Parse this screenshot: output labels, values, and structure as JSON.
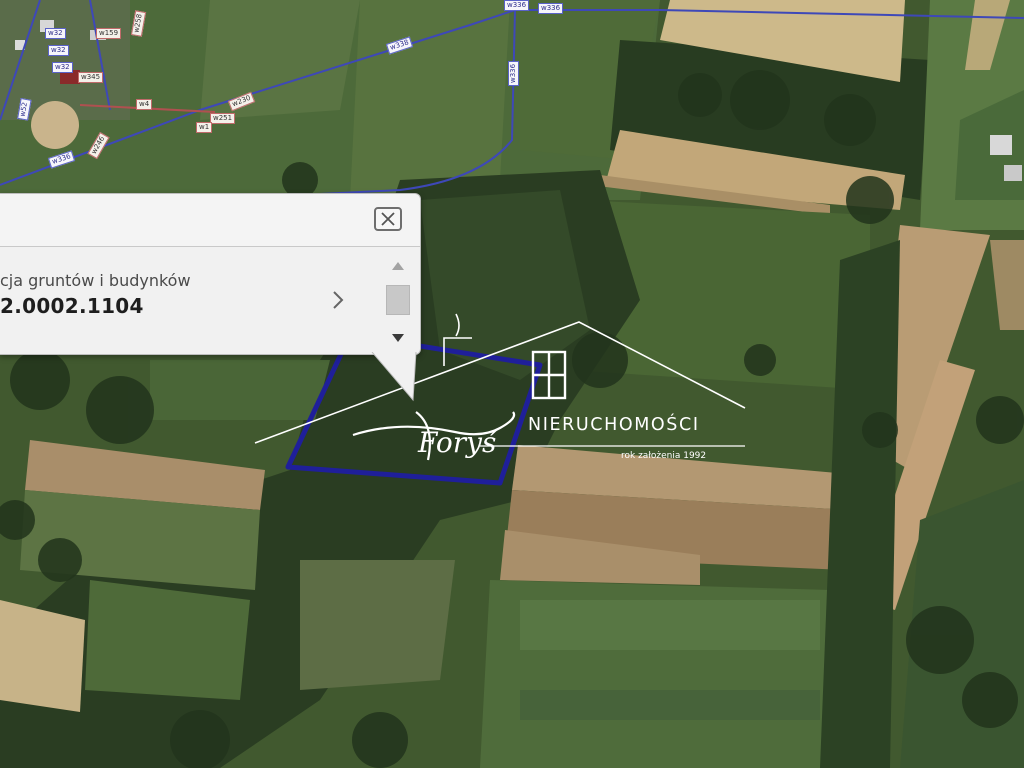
{
  "popup": {
    "subtitle": "cja gruntów i budynków",
    "parcel_id": "2.0002.1104",
    "close_icon": "close-x-icon",
    "next_icon": "chevron-right-icon",
    "scroll_up_icon": "triangle-up-icon",
    "scroll_down_icon": "triangle-down-icon"
  },
  "watermark": {
    "script_name": "Foryś",
    "company": "NIERUCHOMOŚCI",
    "tagline": "rok założenia 1992"
  },
  "map": {
    "boundary_color": "#1f1f9a",
    "road_line_color": "#3e48b8",
    "labels": [
      "w336",
      "w336",
      "w338",
      "w336",
      "w336",
      "w230",
      "w246",
      "w251",
      "w258",
      "w32",
      "w32",
      "w32",
      "w159",
      "w345",
      "w1",
      "w4",
      "w52"
    ]
  },
  "colors": {
    "popup_bg": "#f1f1f1",
    "popup_text": "#1e1e1e",
    "watermark": "#ffffff"
  }
}
